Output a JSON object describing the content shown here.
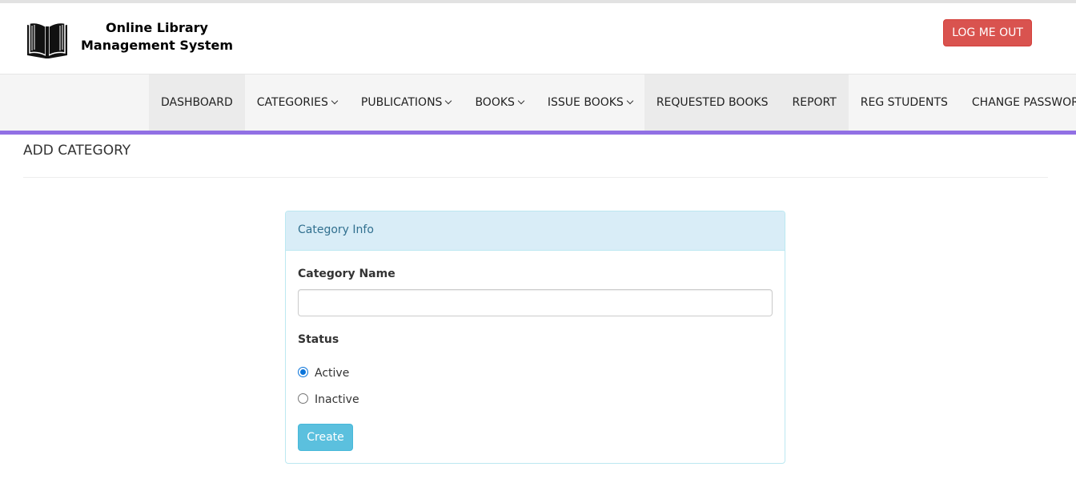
{
  "header": {
    "brand_line1": "Online Library",
    "brand_line2": "Management System",
    "logout_label": "LOG ME OUT",
    "logo_icon": "open-book-icon"
  },
  "nav": {
    "items": [
      {
        "label": "DASHBOARD",
        "dropdown": false,
        "active": true
      },
      {
        "label": "CATEGORIES",
        "dropdown": true,
        "active": false
      },
      {
        "label": "PUBLICATIONS",
        "dropdown": true,
        "active": false
      },
      {
        "label": "BOOKS",
        "dropdown": true,
        "active": false
      },
      {
        "label": "ISSUE BOOKS",
        "dropdown": true,
        "active": false
      },
      {
        "label": "REQUESTED BOOKS",
        "dropdown": false,
        "active": true
      },
      {
        "label": "REPORT",
        "dropdown": false,
        "active": true
      },
      {
        "label": "REG STUDENTS",
        "dropdown": false,
        "active": false
      },
      {
        "label": "CHANGE PASSWORD",
        "dropdown": false,
        "active": false
      }
    ],
    "accent_color": "#9170e4"
  },
  "main": {
    "page_title": "ADD CATEGORY",
    "panel": {
      "heading": "Category Info",
      "category_name_label": "Category Name",
      "category_name_value": "",
      "status_label": "Status",
      "status_options": [
        "Active",
        "Inactive"
      ],
      "status_selected": "Active",
      "create_label": "Create"
    }
  }
}
